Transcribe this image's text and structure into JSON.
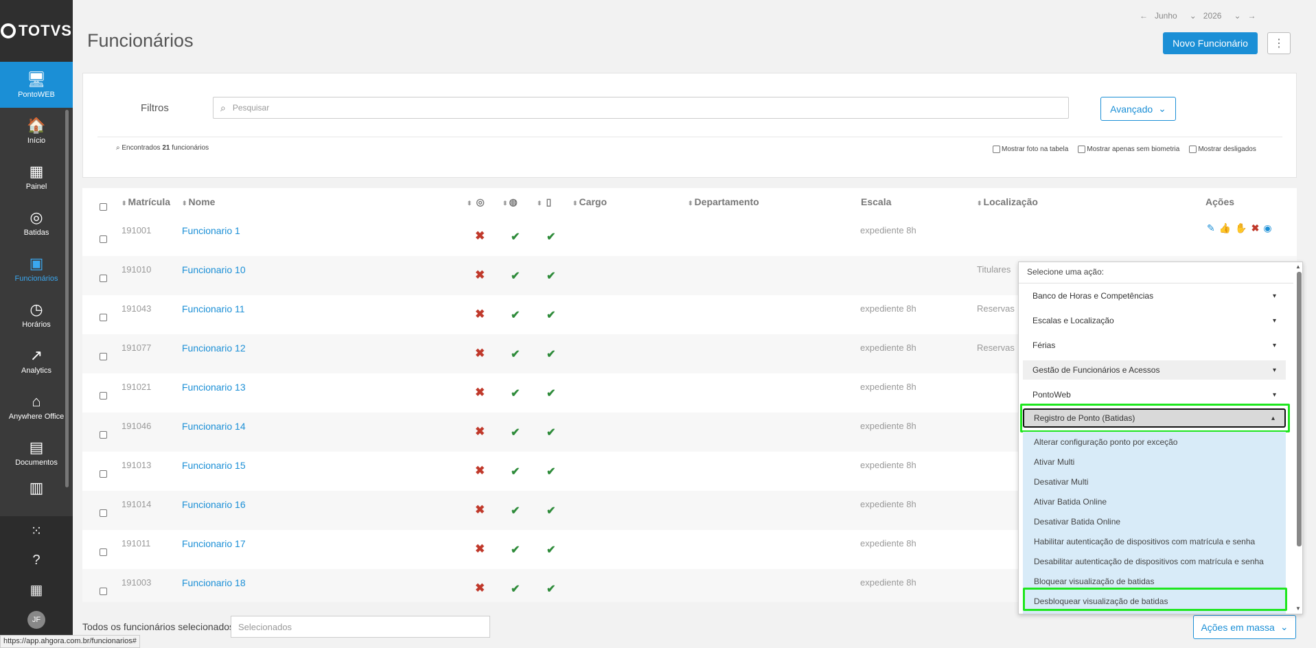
{
  "sidebar": {
    "logo": "TOTVS",
    "items": [
      {
        "label": "PontoWEB",
        "icon": "monitor-icon",
        "glyph": "🖥"
      },
      {
        "label": "Início",
        "icon": "home-icon",
        "glyph": "🏠"
      },
      {
        "label": "Painel",
        "icon": "dashboard-icon",
        "glyph": "▦"
      },
      {
        "label": "Batidas",
        "icon": "fingerprint-icon",
        "glyph": "◎"
      },
      {
        "label": "Funcionários",
        "icon": "employee-badge-icon",
        "glyph": "▣"
      },
      {
        "label": "Horários",
        "icon": "clock-icon",
        "glyph": "◷"
      },
      {
        "label": "Analytics",
        "icon": "trend-icon",
        "glyph": "↗"
      },
      {
        "label": "Anywhere Office",
        "icon": "home-office-icon",
        "glyph": "⌂"
      },
      {
        "label": "Documentos",
        "icon": "document-icon",
        "glyph": "▤"
      }
    ],
    "avatar": "JF"
  },
  "header": {
    "title": "Funcionários",
    "month": "Junho",
    "year": "2026",
    "new_button": "Novo Funcionário"
  },
  "filters": {
    "label": "Filtros",
    "search_placeholder": "Pesquisar",
    "advanced_button": "Avançado",
    "found_prefix": "Encontrados",
    "found_count": "21",
    "found_suffix": "funcionários",
    "opt_photo": "Mostrar foto na tabela",
    "opt_no_bio": "Mostrar apenas sem biometria",
    "opt_disabled": "Mostrar desligados"
  },
  "table": {
    "headers": {
      "matricula": "Matrícula",
      "nome": "Nome",
      "cargo": "Cargo",
      "departamento": "Departamento",
      "escala": "Escala",
      "localizacao": "Localização",
      "acoes": "Ações"
    },
    "rows": [
      {
        "matricula": "191001",
        "nome": "Funcionario 1",
        "escala": "expediente 8h",
        "loc": ""
      },
      {
        "matricula": "191010",
        "nome": "Funcionario 10",
        "escala": "",
        "loc": "Titulares"
      },
      {
        "matricula": "191043",
        "nome": "Funcionario 11",
        "escala": "expediente 8h",
        "loc": "Reservas"
      },
      {
        "matricula": "191077",
        "nome": "Funcionario 12",
        "escala": "expediente 8h",
        "loc": "Reservas"
      },
      {
        "matricula": "191021",
        "nome": "Funcionario 13",
        "escala": "expediente 8h",
        "loc": ""
      },
      {
        "matricula": "191046",
        "nome": "Funcionario 14",
        "escala": "expediente 8h",
        "loc": ""
      },
      {
        "matricula": "191013",
        "nome": "Funcionario 15",
        "escala": "expediente 8h",
        "loc": ""
      },
      {
        "matricula": "191014",
        "nome": "Funcionario 16",
        "escala": "expediente 8h",
        "loc": ""
      },
      {
        "matricula": "191011",
        "nome": "Funcionario 17",
        "escala": "expediente 8h",
        "loc": ""
      },
      {
        "matricula": "191003",
        "nome": "Funcionario 18",
        "escala": "expediente 8h",
        "loc": ""
      }
    ]
  },
  "footer": {
    "all_selected_label": "Todos os funcionários selecionados",
    "selected_placeholder": "Selecionados",
    "mass_actions_button": "Ações em massa",
    "status_url": "https://app.ahgora.com.br/funcionarios#"
  },
  "dropdown": {
    "title": "Selecione uma ação:",
    "groups": [
      "Banco de Horas e Competências",
      "Escalas e Localização",
      "Férias",
      "Gestão de Funcionários e Acessos",
      "PontoWeb",
      "Registro de Ponto (Batidas)"
    ],
    "sub_items": [
      "Alterar configuração ponto por exceção",
      "Ativar Multi",
      "Desativar Multi",
      "Ativar Batida Online",
      "Desativar Batida Online",
      "Habilitar autenticação de dispositivos com matrícula e senha",
      "Desabilitar autenticação de dispositivos com matrícula e senha",
      "Bloquear visualização de batidas",
      "Desbloquear visualização de batidas"
    ]
  },
  "colors": {
    "accent": "#1b8fd6",
    "sidebar": "#3a3a3a",
    "error": "#c0392b",
    "success": "#2e8b3a",
    "highlight_box": "#1ee61e",
    "submenu_bg": "#d8ebf8"
  }
}
